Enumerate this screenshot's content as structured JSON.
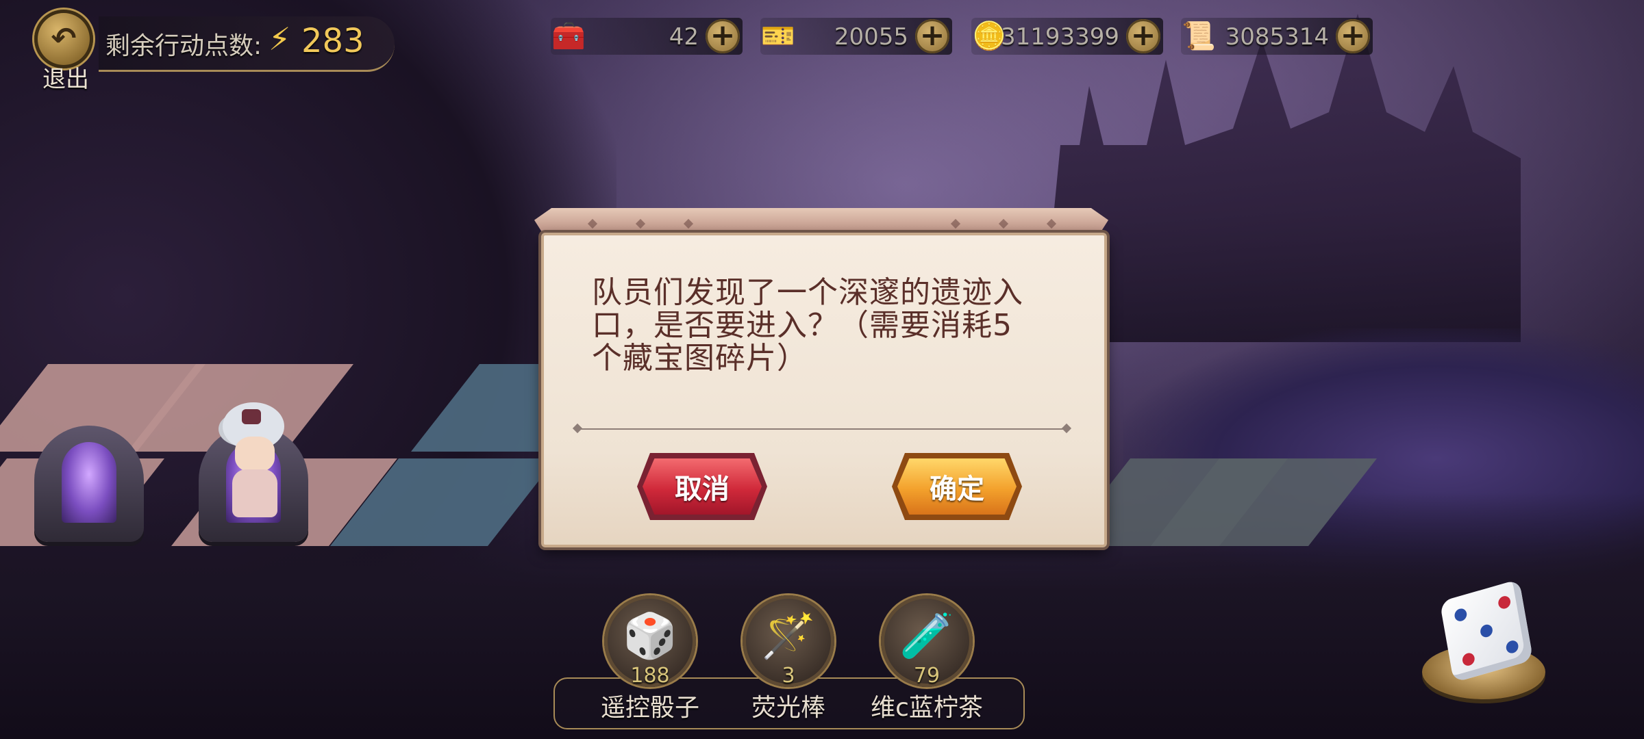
{
  "top_bar": {
    "exit_label": "退出",
    "action_points_label": "剩余行动点数:",
    "action_points_value": "283"
  },
  "resources": [
    {
      "icon": "treasure-chest-icon",
      "value": "42"
    },
    {
      "icon": "blue-card-icon",
      "value": "20055"
    },
    {
      "icon": "gold-coin-icon",
      "value": "31193399"
    },
    {
      "icon": "gold-fragment-icon",
      "value": "3085314"
    }
  ],
  "dialog": {
    "message": "队员们发现了一个深邃的遗迹入口，是否要进入？（需要消耗5个藏宝图碎片）",
    "cancel_label": "取消",
    "confirm_label": "确定"
  },
  "items": [
    {
      "name": "遥控骰子",
      "count": "188",
      "icon": "remote-dice-icon"
    },
    {
      "name": "荧光棒",
      "count": "3",
      "icon": "glow-stick-icon"
    },
    {
      "name": "维c蓝柠茶",
      "count": "79",
      "icon": "blue-lemon-tea-icon"
    }
  ],
  "colors": {
    "accent_gold": "#f1c85a",
    "cancel_red": "#d0293a",
    "confirm_orange": "#f3a12c",
    "dialog_text": "#5a2f29"
  }
}
